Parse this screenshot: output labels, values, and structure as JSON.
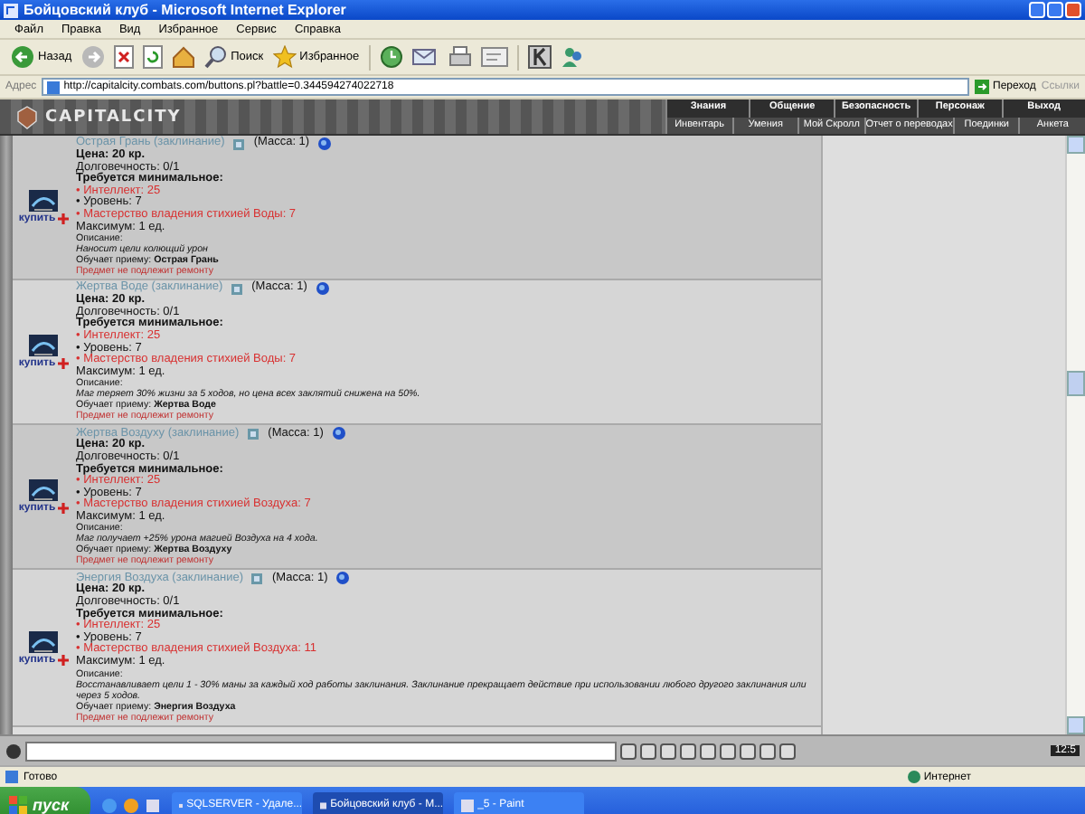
{
  "window": {
    "title": "Бойцовский клуб - Microsoft Internet Explorer"
  },
  "menu": [
    "Файл",
    "Правка",
    "Вид",
    "Избранное",
    "Сервис",
    "Справка"
  ],
  "toolbar": [
    {
      "kind": "back",
      "label": "Назад"
    },
    {
      "kind": "forward"
    },
    {
      "kind": "stop"
    },
    {
      "kind": "refresh"
    },
    {
      "kind": "home"
    },
    {
      "kind": "search",
      "label": "Поиск"
    },
    {
      "kind": "favorites",
      "label": "Избранное"
    },
    {
      "kind": "history"
    },
    {
      "kind": "mail"
    },
    {
      "kind": "print"
    },
    {
      "kind": "edit"
    },
    {
      "kind": "k"
    },
    {
      "kind": "messenger"
    }
  ],
  "address": {
    "label": "Адрес",
    "url": "http://capitalcity.combats.com/buttons.pl?battle=0.344594274022718",
    "go": "Переход",
    "links": "Ссылки"
  },
  "game_header": {
    "logo": "CAPITALCITY",
    "top_nav": [
      "Знания",
      "Общение",
      "Безопасность",
      "Персонаж",
      "Выход"
    ],
    "sub_nav": [
      "Инвентарь",
      "Умения",
      "Мой Скролл",
      "Отчет о переводах",
      "Поединки",
      "Анкета"
    ]
  },
  "items": [
    {
      "name": "Острая Грань (заклинание)",
      "mass": "(Масса: 1)",
      "buy": "купить",
      "price": "Цена: 20 кр.",
      "durability": "Долговечность: 0/1",
      "req_title": "Требуется минимальное:",
      "requirements": [
        {
          "text": "• Интеллект: 25",
          "met": false
        },
        {
          "text": "• Уровень: 7",
          "met": true
        },
        {
          "text": "• Мастерство владения стихией Воды: 7",
          "met": false
        }
      ],
      "max": "Максимум: 1 ед.",
      "desc_label": "Описание:",
      "description": "Наносит цели колющий урон",
      "teaches": "Обучает приему: **Острая Грань**",
      "repair": "Предмет не подлежит ремонту"
    },
    {
      "name": "Жертва Воде (заклинание)",
      "mass": "(Масса: 1)",
      "buy": "купить",
      "price": "Цена: 20 кр.",
      "durability": "Долговечность: 0/1",
      "req_title": "Требуется минимальное:",
      "requirements": [
        {
          "text": "• Интеллект: 25",
          "met": false
        },
        {
          "text": "• Уровень: 7",
          "met": true
        },
        {
          "text": "• Мастерство владения стихией Воды: 7",
          "met": false
        }
      ],
      "max": "Максимум: 1 ед.",
      "desc_label": "Описание:",
      "description": "Маг теряет 30% жизни за 5 ходов, но цена всех заклятий снижена на 50%.",
      "teaches": "Обучает приему: **Жертва Воде**",
      "repair": "Предмет не подлежит ремонту"
    },
    {
      "name": "Жертва Воздуху (заклинание)",
      "mass": "(Масса: 1)",
      "buy": "купить",
      "price": "Цена: 20 кр.",
      "durability": "Долговечность: 0/1",
      "req_title": "Требуется минимальное:",
      "requirements": [
        {
          "text": "• Интеллект: 25",
          "met": false
        },
        {
          "text": "• Уровень: 7",
          "met": true
        },
        {
          "text": "• Мастерство владения стихией Воздуха: 7",
          "met": false
        }
      ],
      "max": "Максимум: 1 ед.",
      "desc_label": "Описание:",
      "description": "Маг получает +25% урона магией Воздуха на 4 хода.",
      "teaches": "Обучает приему: **Жертва Воздуху**",
      "repair": "Предмет не подлежит ремонту"
    },
    {
      "name": "Энергия Воздуха (заклинание)",
      "mass": "(Масса: 1)",
      "buy": "купить",
      "price": "Цена: 20 кр.",
      "durability": "Долговечность: 0/1",
      "req_title": "Требуется минимальное:",
      "requirements": [
        {
          "text": "• Интеллект: 25",
          "met": false
        },
        {
          "text": "• Уровень: 7",
          "met": true
        },
        {
          "text": "• Мастерство владения стихией Воздуха: 11",
          "met": false
        }
      ],
      "max": "Максимум: 1 ед.",
      "desc_label": "Описание:",
      "description": "Восстанавливает цели 1 - 30% маны за каждый ход работы заклинания. Заклинание прекращает действие при использовании любого другого заклинания или через 5 ходов.",
      "teaches": "Обучает приему: **Энергия Воздуха**",
      "repair": "Предмет не подлежит ремонту"
    }
  ],
  "chat": {
    "clock": "12:5"
  },
  "status_bar": {
    "text": "Готово",
    "zone": "Интернет"
  },
  "taskbar": {
    "start": "пуск",
    "tasks": [
      {
        "label": "SQLSERVER - Удале...",
        "selected": false
      },
      {
        "label": "Бойцовский клуб - M...",
        "selected": true
      },
      {
        "label": "_5 - Paint",
        "selected": false
      }
    ]
  }
}
